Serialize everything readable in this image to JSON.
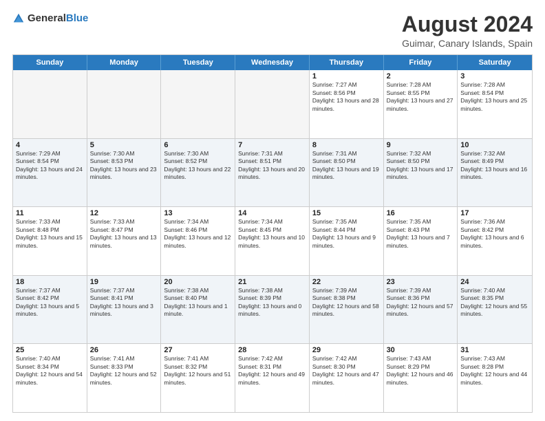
{
  "logo": {
    "general": "General",
    "blue": "Blue"
  },
  "title": "August 2024",
  "location": "Guimar, Canary Islands, Spain",
  "days_of_week": [
    "Sunday",
    "Monday",
    "Tuesday",
    "Wednesday",
    "Thursday",
    "Friday",
    "Saturday"
  ],
  "weeks": [
    [
      {
        "day": "",
        "empty": true
      },
      {
        "day": "",
        "empty": true
      },
      {
        "day": "",
        "empty": true
      },
      {
        "day": "",
        "empty": true
      },
      {
        "day": "1",
        "sunrise": "7:27 AM",
        "sunset": "8:56 PM",
        "daylight": "13 hours and 28 minutes."
      },
      {
        "day": "2",
        "sunrise": "7:28 AM",
        "sunset": "8:55 PM",
        "daylight": "13 hours and 27 minutes."
      },
      {
        "day": "3",
        "sunrise": "7:28 AM",
        "sunset": "8:54 PM",
        "daylight": "13 hours and 25 minutes."
      }
    ],
    [
      {
        "day": "4",
        "sunrise": "7:29 AM",
        "sunset": "8:54 PM",
        "daylight": "13 hours and 24 minutes."
      },
      {
        "day": "5",
        "sunrise": "7:30 AM",
        "sunset": "8:53 PM",
        "daylight": "13 hours and 23 minutes."
      },
      {
        "day": "6",
        "sunrise": "7:30 AM",
        "sunset": "8:52 PM",
        "daylight": "13 hours and 22 minutes."
      },
      {
        "day": "7",
        "sunrise": "7:31 AM",
        "sunset": "8:51 PM",
        "daylight": "13 hours and 20 minutes."
      },
      {
        "day": "8",
        "sunrise": "7:31 AM",
        "sunset": "8:50 PM",
        "daylight": "13 hours and 19 minutes."
      },
      {
        "day": "9",
        "sunrise": "7:32 AM",
        "sunset": "8:50 PM",
        "daylight": "13 hours and 17 minutes."
      },
      {
        "day": "10",
        "sunrise": "7:32 AM",
        "sunset": "8:49 PM",
        "daylight": "13 hours and 16 minutes."
      }
    ],
    [
      {
        "day": "11",
        "sunrise": "7:33 AM",
        "sunset": "8:48 PM",
        "daylight": "13 hours and 15 minutes."
      },
      {
        "day": "12",
        "sunrise": "7:33 AM",
        "sunset": "8:47 PM",
        "daylight": "13 hours and 13 minutes."
      },
      {
        "day": "13",
        "sunrise": "7:34 AM",
        "sunset": "8:46 PM",
        "daylight": "13 hours and 12 minutes."
      },
      {
        "day": "14",
        "sunrise": "7:34 AM",
        "sunset": "8:45 PM",
        "daylight": "13 hours and 10 minutes."
      },
      {
        "day": "15",
        "sunrise": "7:35 AM",
        "sunset": "8:44 PM",
        "daylight": "13 hours and 9 minutes."
      },
      {
        "day": "16",
        "sunrise": "7:35 AM",
        "sunset": "8:43 PM",
        "daylight": "13 hours and 7 minutes."
      },
      {
        "day": "17",
        "sunrise": "7:36 AM",
        "sunset": "8:42 PM",
        "daylight": "13 hours and 6 minutes."
      }
    ],
    [
      {
        "day": "18",
        "sunrise": "7:37 AM",
        "sunset": "8:42 PM",
        "daylight": "13 hours and 5 minutes."
      },
      {
        "day": "19",
        "sunrise": "7:37 AM",
        "sunset": "8:41 PM",
        "daylight": "13 hours and 3 minutes."
      },
      {
        "day": "20",
        "sunrise": "7:38 AM",
        "sunset": "8:40 PM",
        "daylight": "13 hours and 1 minute."
      },
      {
        "day": "21",
        "sunrise": "7:38 AM",
        "sunset": "8:39 PM",
        "daylight": "13 hours and 0 minutes."
      },
      {
        "day": "22",
        "sunrise": "7:39 AM",
        "sunset": "8:38 PM",
        "daylight": "12 hours and 58 minutes."
      },
      {
        "day": "23",
        "sunrise": "7:39 AM",
        "sunset": "8:36 PM",
        "daylight": "12 hours and 57 minutes."
      },
      {
        "day": "24",
        "sunrise": "7:40 AM",
        "sunset": "8:35 PM",
        "daylight": "12 hours and 55 minutes."
      }
    ],
    [
      {
        "day": "25",
        "sunrise": "7:40 AM",
        "sunset": "8:34 PM",
        "daylight": "12 hours and 54 minutes."
      },
      {
        "day": "26",
        "sunrise": "7:41 AM",
        "sunset": "8:33 PM",
        "daylight": "12 hours and 52 minutes."
      },
      {
        "day": "27",
        "sunrise": "7:41 AM",
        "sunset": "8:32 PM",
        "daylight": "12 hours and 51 minutes."
      },
      {
        "day": "28",
        "sunrise": "7:42 AM",
        "sunset": "8:31 PM",
        "daylight": "12 hours and 49 minutes."
      },
      {
        "day": "29",
        "sunrise": "7:42 AM",
        "sunset": "8:30 PM",
        "daylight": "12 hours and 47 minutes."
      },
      {
        "day": "30",
        "sunrise": "7:43 AM",
        "sunset": "8:29 PM",
        "daylight": "12 hours and 46 minutes."
      },
      {
        "day": "31",
        "sunrise": "7:43 AM",
        "sunset": "8:28 PM",
        "daylight": "12 hours and 44 minutes."
      }
    ]
  ],
  "labels": {
    "sunrise": "Sunrise:",
    "sunset": "Sunset:",
    "daylight": "Daylight:"
  }
}
